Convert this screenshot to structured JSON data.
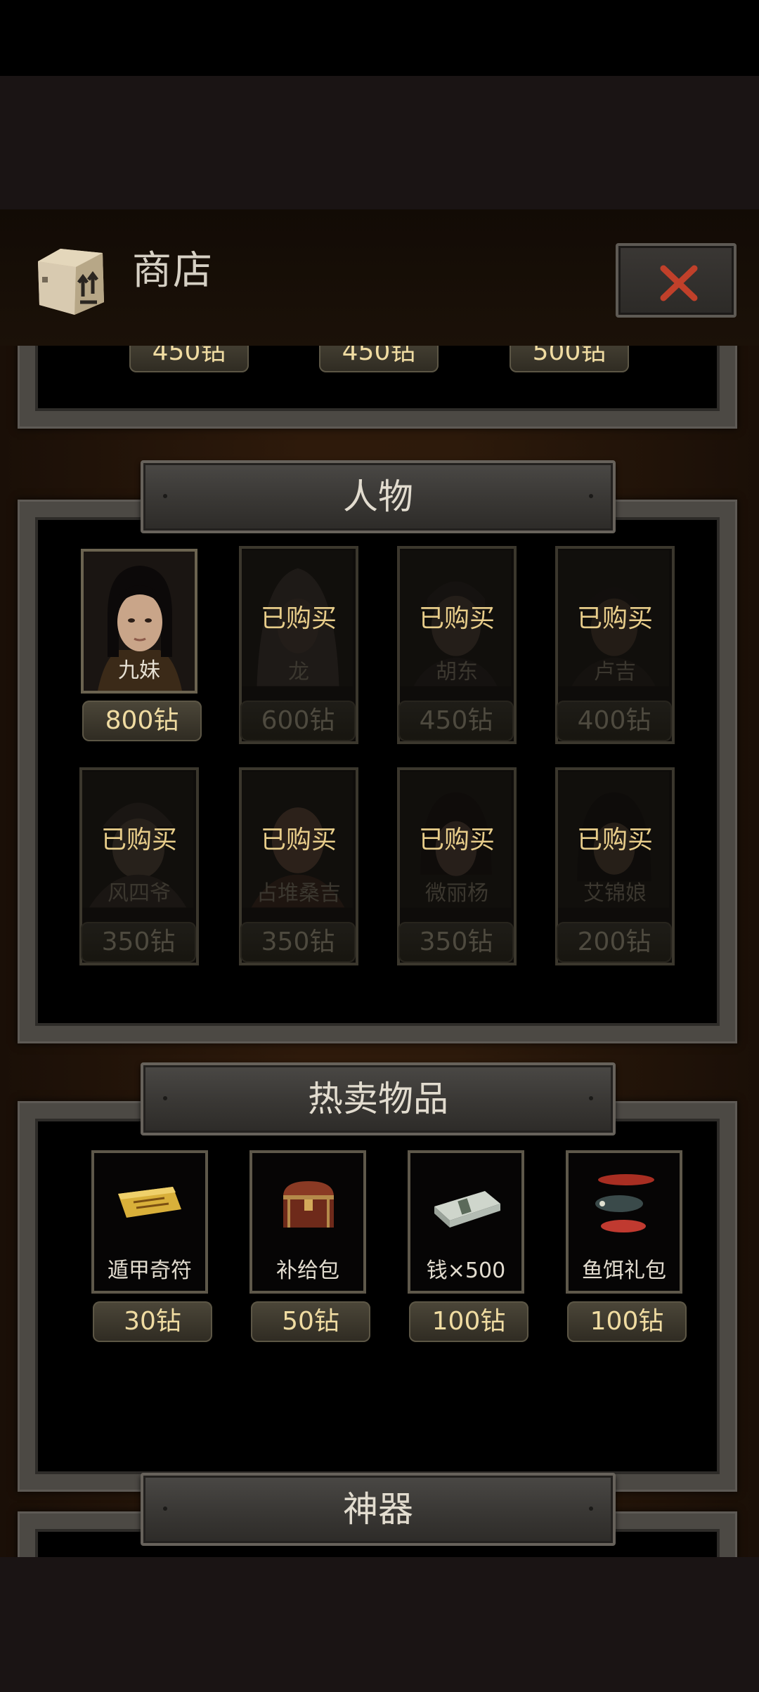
{
  "header": {
    "title": "商店",
    "close_icon": "close-x-icon",
    "shop_icon": "box-icon"
  },
  "top_section": {
    "prices": [
      "450钻",
      "450钻",
      "500钻"
    ]
  },
  "characters": {
    "title": "人物",
    "owned_label": "已购买",
    "items": [
      {
        "name": "九妹",
        "price": "800钻",
        "owned": false
      },
      {
        "name": "龙",
        "price": "600钻",
        "owned": true
      },
      {
        "name": "胡东",
        "price": "450钻",
        "owned": true
      },
      {
        "name": "卢吉",
        "price": "400钻",
        "owned": true
      },
      {
        "name": "风四爷",
        "price": "350钻",
        "owned": true
      },
      {
        "name": "占堆桑吉",
        "price": "350钻",
        "owned": true
      },
      {
        "name": "微丽杨",
        "price": "350钻",
        "owned": true
      },
      {
        "name": "艾锦娘",
        "price": "200钻",
        "owned": true
      }
    ]
  },
  "hot_items": {
    "title": "热卖物品",
    "items": [
      {
        "name": "遁甲奇符",
        "price": "30钻",
        "icon": "talisman-icon"
      },
      {
        "name": "补给包",
        "price": "50钻",
        "icon": "chest-icon"
      },
      {
        "name": "钱×500",
        "price": "100钻",
        "icon": "money-stack-icon"
      },
      {
        "name": "鱼饵礼包",
        "price": "100钻",
        "icon": "fishing-lure-icon"
      }
    ]
  },
  "artifacts": {
    "title": "神器"
  },
  "colors": {
    "gold_text": "#f0dca2",
    "owned_text": "#e8cd8a",
    "frame": "#4c4944"
  }
}
